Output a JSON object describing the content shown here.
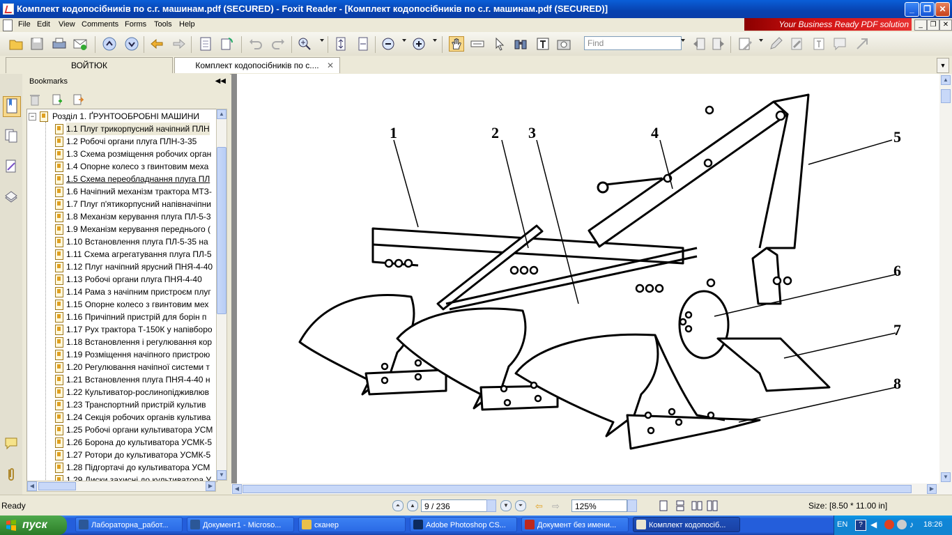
{
  "window": {
    "title": "Комплект кодопосібників по с.г. машинам.pdf (SECURED) - Foxit Reader - [Комплект кодопосібників по с.г. машинам.pdf (SECURED)]",
    "controls": [
      "_",
      "❐",
      "✕"
    ]
  },
  "menu": {
    "items": [
      "File",
      "Edit",
      "View",
      "Comments",
      "Forms",
      "Tools",
      "Help"
    ],
    "ad_banner": "Your Business Ready PDF solution"
  },
  "toolbar": {
    "find_placeholder": "Find"
  },
  "tabs": [
    {
      "label": "ВОЙТЮК"
    },
    {
      "label": "Комплект кодопосібників по с...."
    }
  ],
  "bookmarks": {
    "header": "Bookmarks",
    "root": "Розділ 1. ҐРУНТООБРОБНІ МАШИНИ",
    "items": [
      "1.1 Плуг трикорпусний начіпний ПЛН",
      "1.2 Робочі органи плуга ПЛН-3-35",
      "1.3 Схема розміщення робочих орган",
      "1.4 Опорне колесо з гвинтовим меха",
      "1.5 Схема переобладнання плуга ПЛ",
      "1.6 Начіпний механізм трактора МТЗ-",
      "1.7 Плуг п'ятикорпусний напівначіпни",
      "1.8 Механізм керування плуга ПЛ-5-3",
      "1.9 Механізм керування переднього (",
      "1.10 Встановлення плуга ПЛ-5-35 на",
      "1.11 Схема агрегатування плуга ПЛ-5",
      "1.12 Плуг начіпний ярусний ПНЯ-4-40",
      "1.13 Робочі органи плуга ПНЯ-4-40",
      "1.14 Рама з начіпним пристроєм плуг",
      "1.15 Опорне колесо з гвинтовим мех",
      "1.16 Причіпний пристрій для борін п",
      "1.17 Рух трактора Т-150К у напівборо",
      "1.18 Встановлення і регулювання кор",
      "1.19 Розміщення начіпного пристрою",
      "1.20 Регулювання начіпної системи т",
      "1.21 Встановлення плуга ПНЯ-4-40 н",
      "1.22 Культиватор-рослинопідживлюв",
      "1.23 Транспортний пристрій культив",
      "1.24 Секція робочих органів культива",
      "1.25 Робочі органи культиватора УСМ",
      "1.26 Борона до культиватора УСМК-5",
      "1.27 Ротори до культиватора УСМК-5",
      "1.28 Підгортачі до культиватора УСМ",
      "1.29 Диски захисні до культиватора У"
    ]
  },
  "figure_labels": [
    "1",
    "2",
    "3",
    "4",
    "5",
    "6",
    "7",
    "8"
  ],
  "status": {
    "ready": "Ready",
    "page": "9 / 236",
    "zoom": "125%",
    "size": "Size: [8.50 * 11.00 in]"
  },
  "taskbar": {
    "start": "пуск",
    "tasks": [
      {
        "label": "Лабораторна_работ...",
        "color": "#2b5797"
      },
      {
        "label": "Документ1 - Microso...",
        "color": "#2b5797"
      },
      {
        "label": "сканер",
        "color": "#e8c04a"
      },
      {
        "label": "Adobe Photoshop CS...",
        "color": "#0d2b5e"
      },
      {
        "label": "Документ без имени...",
        "color": "#c0281c"
      },
      {
        "label": "Комплект кодопосіб...",
        "color": "#e9e4d0"
      }
    ],
    "lang": "EN",
    "time": "18:26"
  }
}
